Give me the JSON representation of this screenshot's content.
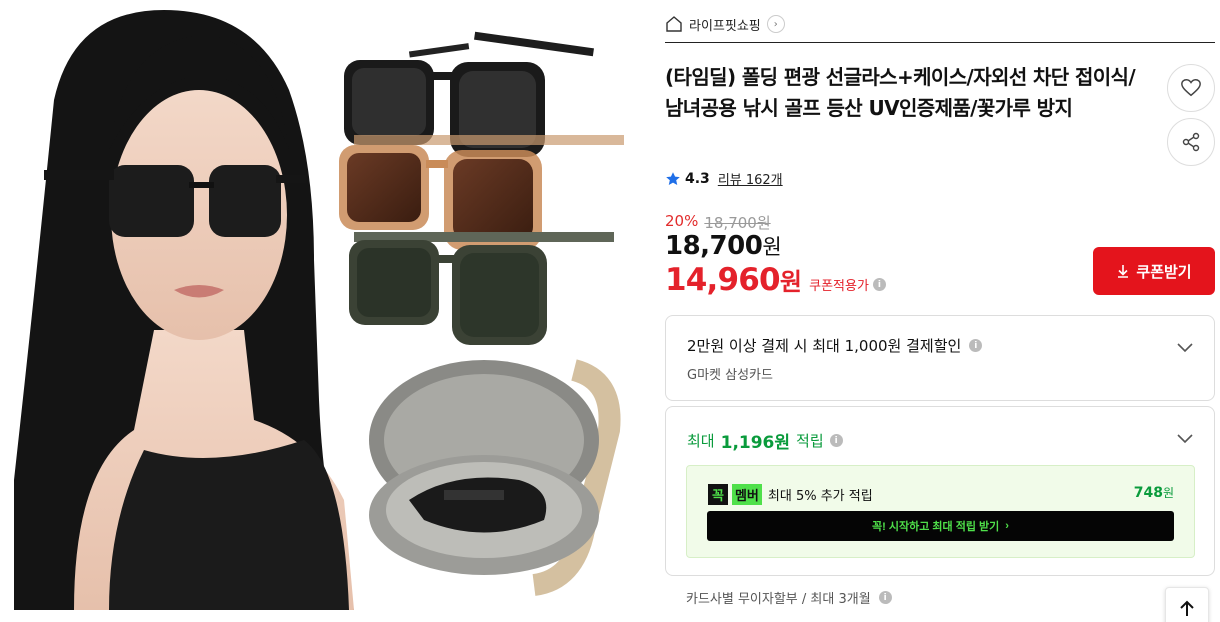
{
  "shop": {
    "name": "라이프핏쇼핑"
  },
  "product": {
    "title": "(타임딜) 폴딩 편광 선글라스+케이스/자외선 차단 접이식/남녀공용 낚시 골프 등산 UV인증제품/꽃가루 방지",
    "rating": "4.3",
    "review_label": "리뷰 162개"
  },
  "price": {
    "discount_rate": "20%",
    "original": "18,700원",
    "sale_number": "18,700",
    "sale_unit": "원",
    "coupon_number": "14,960",
    "coupon_unit": "원",
    "coupon_applied_label": "쿠폰적용가"
  },
  "actions": {
    "coupon_button": "쿠폰받기"
  },
  "card_discount": {
    "text": "2만원 이상 결제 시 최대 1,000원 결제할인",
    "card": "G마켓 삼성카드"
  },
  "points": {
    "prefix": "최대",
    "amount": "1,196원",
    "suffix": "적립",
    "member_badge_1": "꼭",
    "member_badge_2": "멤버",
    "member_text": "최대 5% 추가 적립",
    "member_points_number": "748",
    "member_points_unit": "원",
    "start_button": "꼭! 시작하고 최대 적립 받기"
  },
  "installment": {
    "text": "카드사별 무이자할부 / 최대 3개월"
  },
  "icons": {
    "home": "home-icon",
    "heart": "heart-icon",
    "share": "share-icon",
    "star": "star-icon",
    "download": "download-icon",
    "chevron": "chevron-down-icon",
    "info": "info-icon",
    "arrow_up": "arrow-up-icon"
  },
  "colors": {
    "accent_red": "#e4141c",
    "price_red": "#e4222b",
    "points_green": "#0a9b3c",
    "member_green": "#4fe04a",
    "star_blue": "#1f6fe8"
  }
}
